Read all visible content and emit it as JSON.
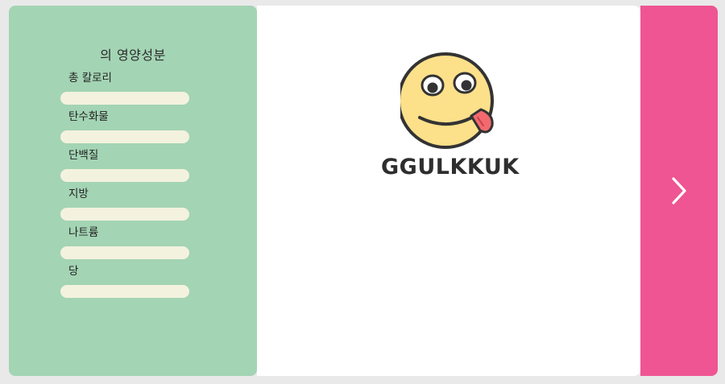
{
  "nutrition_panel": {
    "title": "의 영양성분",
    "items": [
      {
        "label": "총 칼로리"
      },
      {
        "label": "탄수화물"
      },
      {
        "label": "단백질"
      },
      {
        "label": "지방"
      },
      {
        "label": "나트륨"
      },
      {
        "label": "당"
      }
    ]
  },
  "brand": {
    "name": "GGULKKUK",
    "logo_icon": "tongue-out-smiley-icon"
  },
  "navigation": {
    "next_icon": "chevron-right-icon"
  },
  "colors": {
    "left_panel": "#a3d4b4",
    "bar_fill": "#f3f2de",
    "right_panel": "#ee5592",
    "smiley_face": "#fde08a",
    "tongue": "#f26a6f"
  }
}
